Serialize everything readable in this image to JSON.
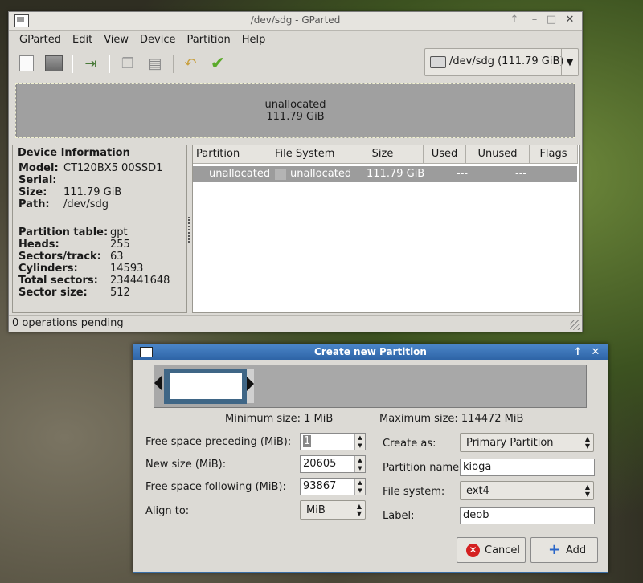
{
  "main": {
    "title": "/dev/sdg - GParted",
    "menu": [
      "GParted",
      "Edit",
      "View",
      "Device",
      "Partition",
      "Help"
    ],
    "device_selector": "/dev/sdg  (111.79 GiB)",
    "diskmap": {
      "label": "unallocated",
      "size": "111.79 GiB"
    },
    "device_info": {
      "heading": "Device Information",
      "rows": [
        {
          "k": "Model:",
          "v": "CT120BX5 00SSD1"
        },
        {
          "k": "Serial:",
          "v": ""
        },
        {
          "k": "Size:",
          "v": "111.79 GiB"
        },
        {
          "k": "Path:",
          "v": "/dev/sdg"
        }
      ],
      "rows2": [
        {
          "k": "Partition table:",
          "v": "gpt"
        },
        {
          "k": "Heads:",
          "v": "255"
        },
        {
          "k": "Sectors/track:",
          "v": "63"
        },
        {
          "k": "Cylinders:",
          "v": "14593"
        },
        {
          "k": "Total sectors:",
          "v": "234441648"
        },
        {
          "k": "Sector size:",
          "v": "512"
        }
      ]
    },
    "table": {
      "headers": [
        "Partition",
        "File System",
        "Size",
        "Used",
        "Unused",
        "Flags"
      ],
      "row": {
        "partition": "unallocated",
        "fs": "unallocated",
        "size": "111.79 GiB",
        "used": "---",
        "unused": "---",
        "flags": ""
      }
    },
    "status": "0 operations pending"
  },
  "dialog": {
    "title": "Create new Partition",
    "min_size": "Minimum size: 1 MiB",
    "max_size": "Maximum size: 114472 MiB",
    "left": {
      "preceding_label": "Free space preceding (MiB):",
      "preceding_value": "1",
      "newsize_label": "New size (MiB):",
      "newsize_value": "20605",
      "following_label": "Free space following (MiB):",
      "following_value": "93867",
      "align_label": "Align to:",
      "align_value": "MiB"
    },
    "right": {
      "create_as_label": "Create as:",
      "create_as_value": "Primary Partition",
      "name_label": "Partition name:",
      "name_value": "kioga",
      "fs_label": "File system:",
      "fs_value": "ext4",
      "label_label": "Label:",
      "label_value": "deob"
    },
    "cancel": "Cancel",
    "add": "Add"
  }
}
